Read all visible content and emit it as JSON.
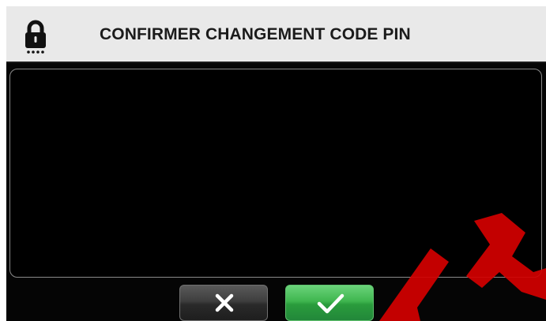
{
  "header": {
    "title": "CONFIRMER CHANGEMENT CODE PIN",
    "icon": "lock-pin-icon"
  },
  "message_panel": {
    "text": ""
  },
  "buttons": {
    "cancel": {
      "icon": "close-icon"
    },
    "confirm": {
      "icon": "checkmark-icon",
      "color": "#3fb64f"
    }
  },
  "colors": {
    "header_bg": "#e9e9e9",
    "screen_bg": "#050505",
    "watermark": "#d40000"
  }
}
